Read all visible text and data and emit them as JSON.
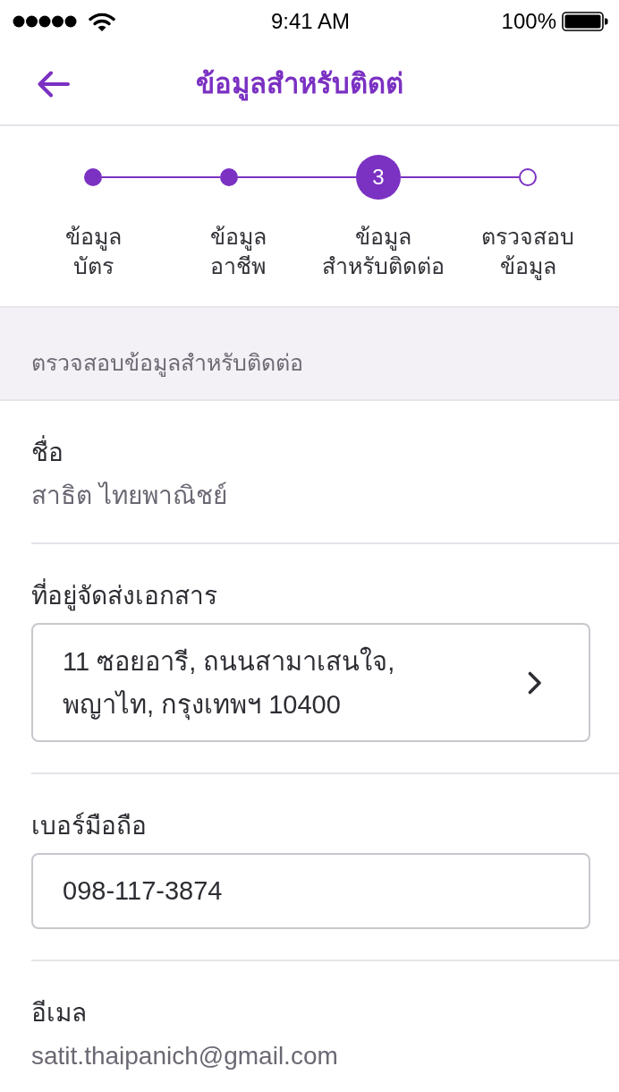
{
  "status_bar": {
    "time": "9:41 AM",
    "battery": "100%"
  },
  "header": {
    "title": "ข้อมูลสำหรับติดต่"
  },
  "stepper": {
    "steps": [
      {
        "label": "ข้อมูล\nบัตร",
        "done": true,
        "selected": false
      },
      {
        "label": "ข้อมูล\nอาชีพ",
        "done": true,
        "selected": false
      },
      {
        "label": "ข้อมูล\nสำหรับติดต่อ",
        "done": false,
        "selected": true,
        "number": "3"
      },
      {
        "label": "ตรวจสอบ\nข้อมูล",
        "done": false,
        "selected": false
      }
    ]
  },
  "section": {
    "title": "ตรวจสอบข้อมูลสำหรับติดต่อ"
  },
  "fields": [
    {
      "kind": "text",
      "label": "ชื่อ",
      "value": "สาธิต ไทยพาณิชย์"
    },
    {
      "kind": "picker",
      "label": "ที่อยู่จัดส่งเอกสาร",
      "value": "11 ซอยอารี, ถนนสามาเสนใจ,\nพญาไท, กรุงเทพฯ 10400"
    },
    {
      "kind": "input",
      "label": "เบอร์มือถือ",
      "value": "098-117-3874"
    },
    {
      "kind": "text",
      "label": "อีเมล",
      "value": "satit.thaipanich@gmail.com"
    }
  ]
}
